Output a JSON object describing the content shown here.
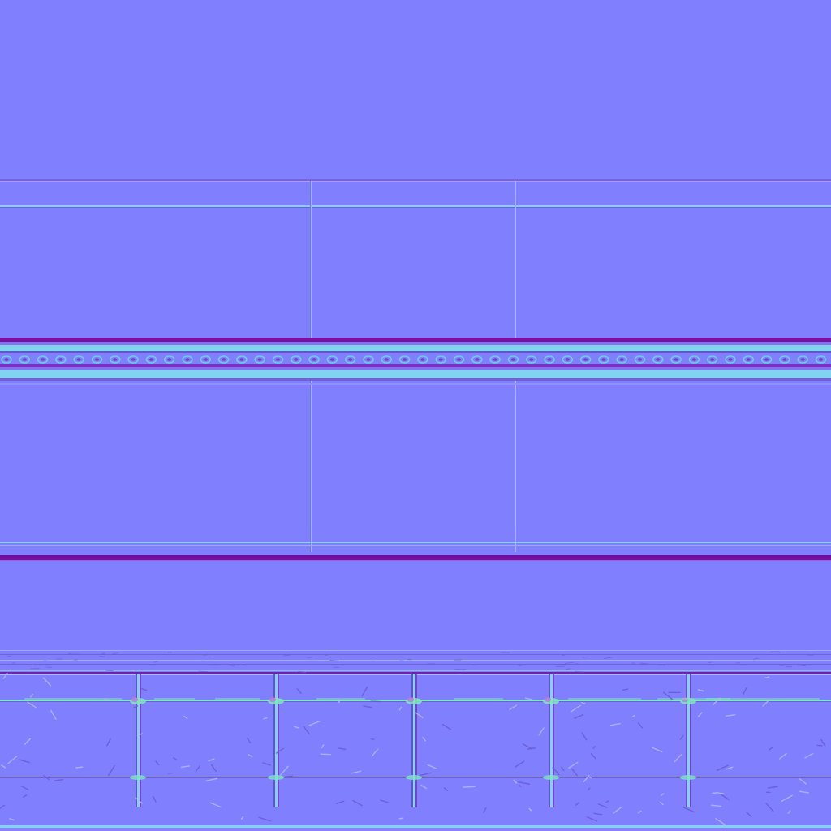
{
  "texture": {
    "kind": "normal-map",
    "base_color": "#8080ff",
    "highlight_color": "#7fd4f0",
    "shadow_color": "#7a1fb0",
    "deep_shadow_color": "#7a0fa0",
    "edge_color": "#a0a0ff",
    "crack_color": "#6a5ad0",
    "green_highlight": "#80e8c0",
    "magenta_highlight": "#c070e0"
  },
  "sections": {
    "upper_panel_divisions": 3,
    "bead_band_beads": 46,
    "lower_panel_posts": 5
  }
}
